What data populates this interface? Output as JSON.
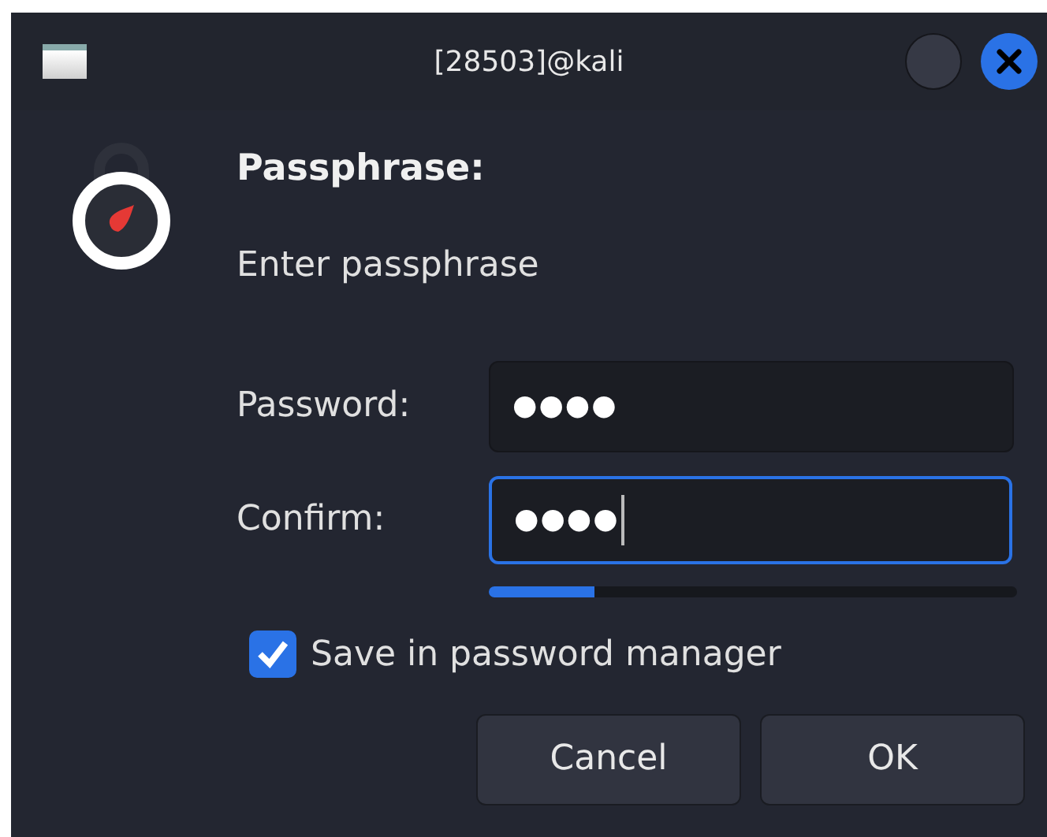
{
  "window": {
    "title": "[28503]@kali"
  },
  "heading": "Passphrase:",
  "description": "Enter passphrase",
  "fields": [
    {
      "label": "Password:",
      "value": "●●●●",
      "focused": false
    },
    {
      "label": "Confirm:",
      "value": "●●●●",
      "focused": true
    }
  ],
  "quality_meter": {
    "level": 0.2
  },
  "save_checkbox": {
    "label": "Save in password manager",
    "checked": true
  },
  "buttons": [
    "Cancel",
    "OK"
  ]
}
